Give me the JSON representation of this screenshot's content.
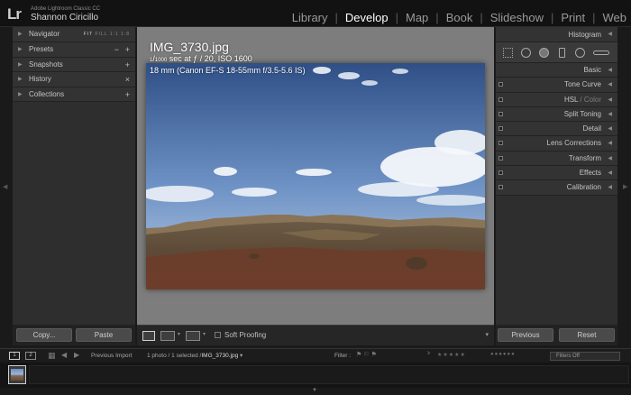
{
  "header": {
    "logo": "Lr",
    "app_name": "Adobe Lightroom Classic CC",
    "user_name": "Shannon Ciricillo",
    "modules": [
      {
        "label": "Library",
        "active": false
      },
      {
        "label": "Develop",
        "active": true
      },
      {
        "label": "Map",
        "active": false
      },
      {
        "label": "Book",
        "active": false
      },
      {
        "label": "Slideshow",
        "active": false
      },
      {
        "label": "Print",
        "active": false
      },
      {
        "label": "Web",
        "active": false
      }
    ],
    "separator": "|"
  },
  "left_panel": {
    "navigator": {
      "label": "Navigator",
      "options": [
        "FIT",
        "FILL",
        "1:1",
        "1:8"
      ]
    },
    "presets": {
      "label": "Presets",
      "minus": "−",
      "plus": "+"
    },
    "snapshots": {
      "label": "Snapshots",
      "plus": "+"
    },
    "history": {
      "label": "History",
      "close": "×"
    },
    "collections": {
      "label": "Collections",
      "plus": "+"
    },
    "copy_button": "Copy...",
    "paste_button": "Paste"
  },
  "image": {
    "filename": "IMG_3730.jpg",
    "shutter_num": "1",
    "shutter_den": "1000",
    "exposure_rest": " sec at ƒ / 20, ISO 1600",
    "lens_info": "18 mm (Canon EF-S 18-55mm f/3.5-5.6 IS)"
  },
  "toolbar": {
    "soft_proofing": "Soft Proofing",
    "view_options": [
      "loupe",
      "before-after-lr",
      "before-after-yy"
    ]
  },
  "right_panel": {
    "histogram": "Histogram",
    "sections": [
      {
        "label": "Basic",
        "has_switch": false
      },
      {
        "label": "Tone Curve",
        "has_switch": true
      },
      {
        "label": "HSL",
        "label_suffix": " / Color",
        "has_switch": true
      },
      {
        "label": "Split Toning",
        "has_switch": true
      },
      {
        "label": "Detail",
        "has_switch": true
      },
      {
        "label": "Lens Corrections",
        "has_switch": true
      },
      {
        "label": "Transform",
        "has_switch": true
      },
      {
        "label": "Effects",
        "has_switch": true
      },
      {
        "label": "Calibration",
        "has_switch": true
      }
    ],
    "previous_button": "Previous",
    "reset_button": "Reset"
  },
  "filmstrip_bar": {
    "monitor_1": "1",
    "monitor_2": "2",
    "source": "Previous Import",
    "selection_prefix": "1 photo / 1 selected /",
    "selection_file": "IMG_3730.jpg",
    "filter_label": "Filter :",
    "filter_value": "Filters Off"
  },
  "icons": {
    "nav_triangle": "▶",
    "panel_triangle": "◀",
    "dropdown": "▾",
    "grid": "grid-icon",
    "back": "◀",
    "forward": "▶"
  },
  "colors": {
    "active_module": "#ffffff",
    "inactive_module": "#9a9a9a",
    "panel_bg": "#2e2e2e",
    "canvas_bg": "#7d7d7d"
  }
}
